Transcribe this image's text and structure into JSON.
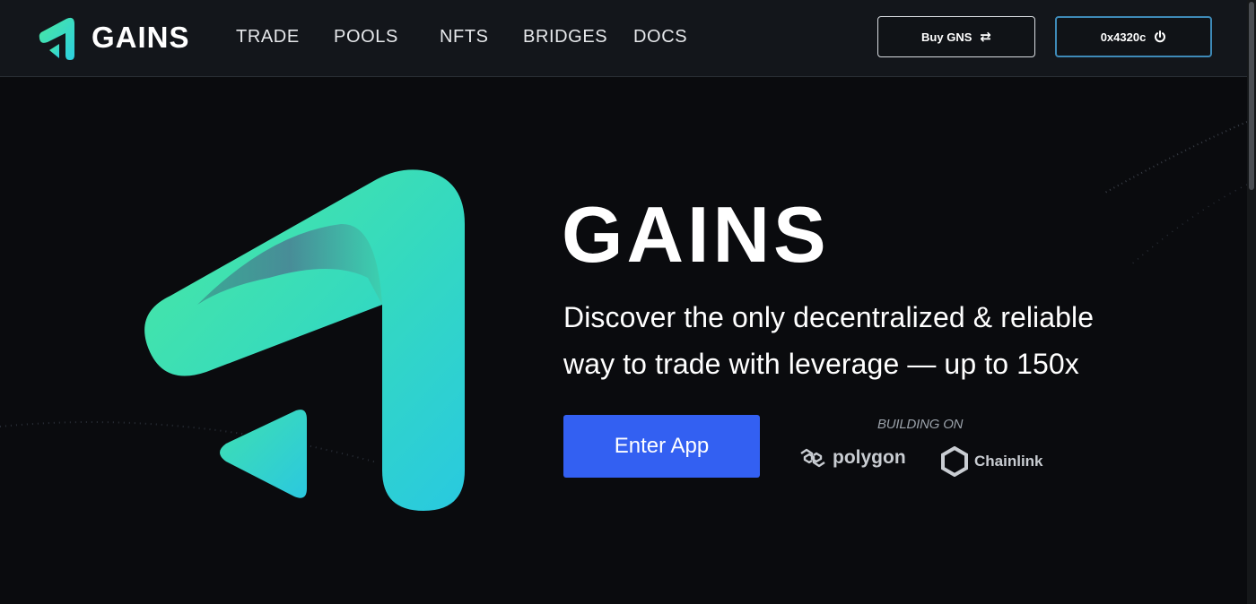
{
  "header": {
    "brand_name": "GAINS",
    "nav": [
      "TRADE",
      "POOLS",
      "NFTS",
      "BRIDGES",
      "DOCS"
    ],
    "buy_button": {
      "label": "Buy GNS",
      "icon": "swap-arrows-icon"
    },
    "wallet_button": {
      "label": "0x4320c",
      "icon": "power-icon"
    }
  },
  "hero": {
    "title": "GAINS",
    "subtitle": "Discover the only decentralized & reliable way to trade with leverage — up to 150x",
    "cta_label": "Enter App",
    "building_on_label": "BUILDING ON",
    "partners": [
      "polygon",
      "Chainlink"
    ]
  },
  "colors": {
    "background": "#0a0b0e",
    "header_background": "#13161b",
    "accent_green": "#4ae8a0",
    "accent_cyan": "#2ccfe0",
    "cta_blue": "#3360f2",
    "wallet_border": "#3e8ab8"
  }
}
